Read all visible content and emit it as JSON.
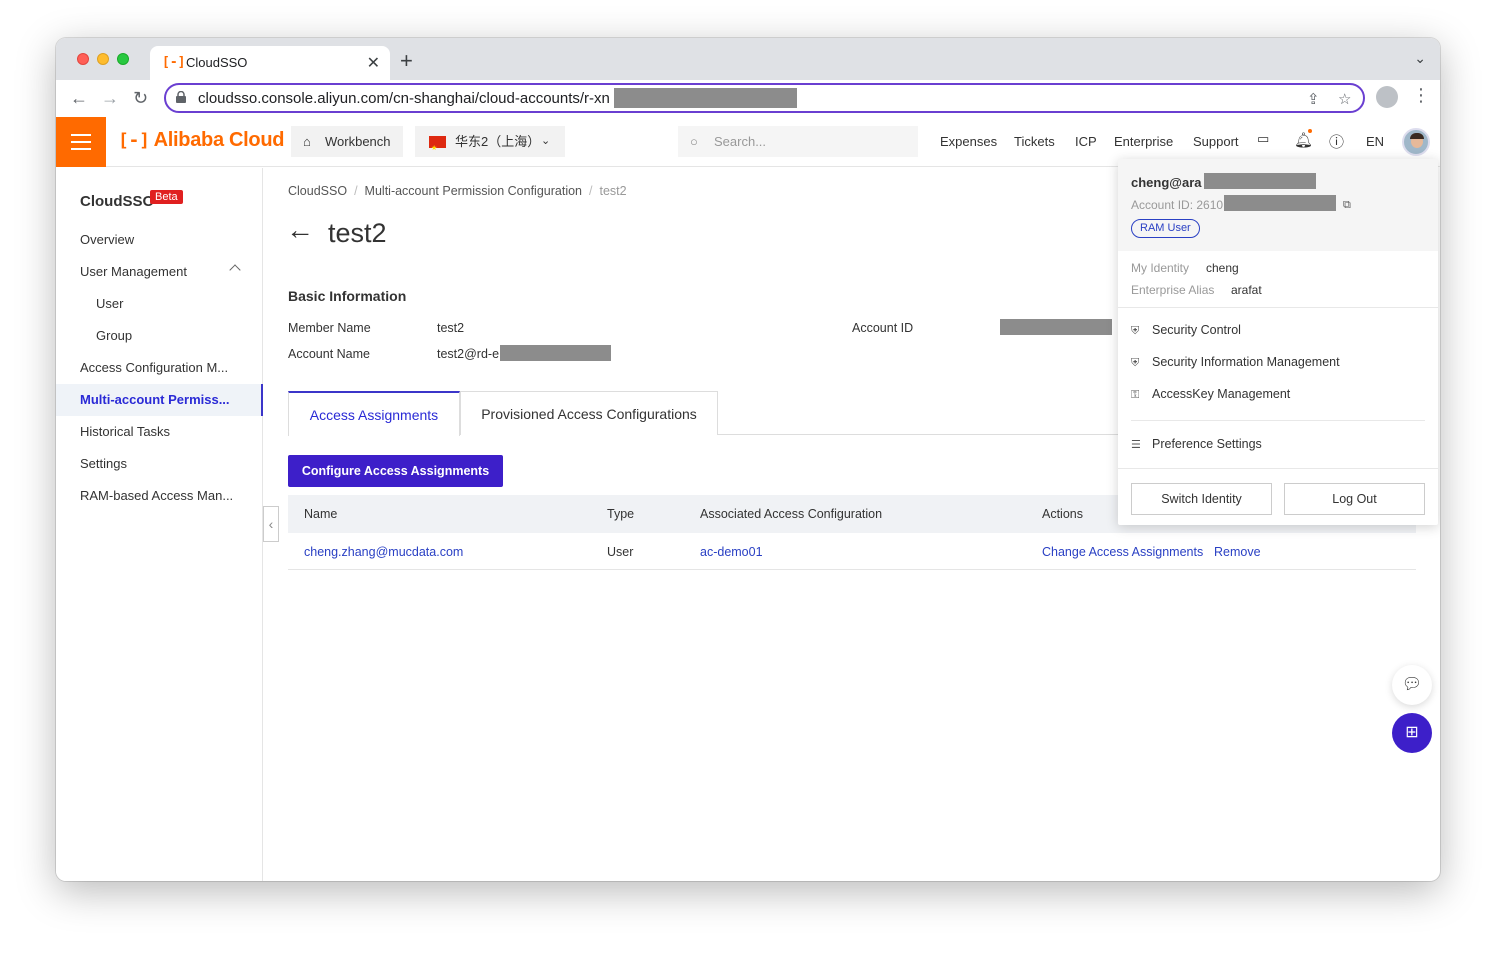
{
  "browser": {
    "tab_title": "CloudSSO",
    "tab_favicon": "alibaba-cloud-icon",
    "url": "cloudsso.console.aliyun.com/cn-shanghai/cloud-accounts/r-xn"
  },
  "header": {
    "logo_text": "Alibaba Cloud",
    "workbench": "Workbench",
    "region": "华东2（上海）",
    "search_placeholder": "Search...",
    "links": [
      "Expenses",
      "Tickets",
      "ICP",
      "Enterprise",
      "Support"
    ],
    "language": "EN",
    "accent": "#ff6a00"
  },
  "sidebar": {
    "title": "CloudSSO",
    "badge": "Beta",
    "items": [
      {
        "label": "Overview"
      },
      {
        "label": "User Management"
      },
      {
        "label": "User"
      },
      {
        "label": "Group"
      },
      {
        "label": "Access Configuration M..."
      },
      {
        "label": "Multi-account Permiss..."
      },
      {
        "label": "Historical Tasks"
      },
      {
        "label": "Settings"
      },
      {
        "label": "RAM-based Access Man..."
      }
    ]
  },
  "main": {
    "breadcrumb": [
      "CloudSSO",
      "Multi-account Permission Configuration",
      "test2"
    ],
    "title": "test2",
    "basic_info": {
      "heading": "Basic Information",
      "member_name_label": "Member Name",
      "member_name": "test2",
      "account_name_label": "Account Name",
      "account_name": "test2@rd-e",
      "account_id_label": "Account ID"
    },
    "tabs": [
      "Access Assignments",
      "Provisioned Access Configurations"
    ],
    "configure_button": "Configure Access Assignments",
    "table": {
      "columns": [
        "Name",
        "Type",
        "Associated Access Configuration",
        "Actions"
      ],
      "rows": [
        {
          "name": "cheng.zhang@mucdata.com",
          "type": "User",
          "config": "ac-demo01",
          "action_change": "Change Access Assignments",
          "action_remove": "Remove"
        }
      ]
    },
    "primary_color": "#3d1fc9"
  },
  "user_menu": {
    "user": "cheng@ara",
    "account_id": "Account ID: 2610",
    "role_badge": "RAM User",
    "identity_label": "My Identity",
    "identity": "cheng",
    "alias_label": "Enterprise Alias",
    "alias": "arafat",
    "items": [
      "Security Control",
      "Security Information Management",
      "AccessKey Management",
      "Preference Settings"
    ],
    "switch_identity": "Switch Identity",
    "log_out": "Log Out"
  }
}
